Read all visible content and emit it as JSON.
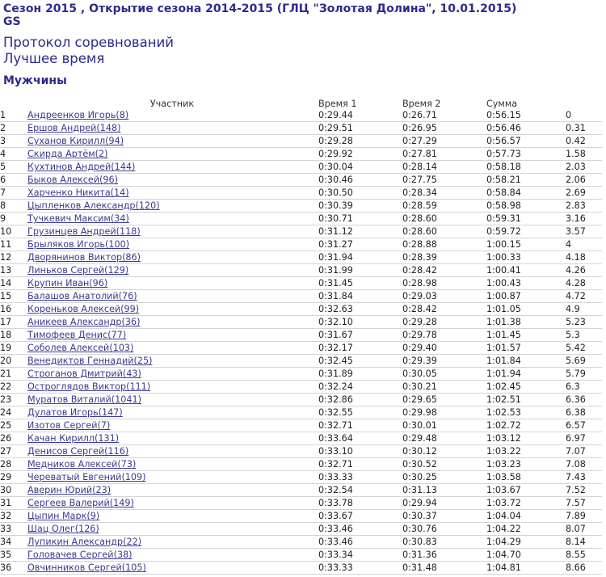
{
  "header": {
    "title": "Сезон 2015 , Открытие сезона 2014-2015 (ГЛЦ \"Золотая Долина\", 10.01.2015)",
    "discipline": "GS",
    "protocol": "Протокол соревнований",
    "best_time": "Лучшее время",
    "group": "Мужчины"
  },
  "table": {
    "columns": [
      "",
      "Участник",
      "Время 1",
      "Время 2",
      "Сумма",
      ""
    ],
    "rows": [
      {
        "place": "1",
        "name": "Андреенков Игорь(8)",
        "t1": "0:29.44",
        "t2": "0:26.71",
        "sum": "0:56.15",
        "gap": "0"
      },
      {
        "place": "2",
        "name": "Ершов Андрей(148)",
        "t1": "0:29.51",
        "t2": "0:26.95",
        "sum": "0:56.46",
        "gap": "0.31"
      },
      {
        "place": "3",
        "name": "Суханов Кирилл(94)",
        "t1": "0:29.28",
        "t2": "0:27.29",
        "sum": "0:56.57",
        "gap": "0.42"
      },
      {
        "place": "4",
        "name": "Скирда Артём(2)",
        "t1": "0:29.92",
        "t2": "0:27.81",
        "sum": "0:57.73",
        "gap": "1.58"
      },
      {
        "place": "5",
        "name": "Кухтинов Андрей(144)",
        "t1": "0:30.04",
        "t2": "0:28.14",
        "sum": "0:58.18",
        "gap": "2.03"
      },
      {
        "place": "6",
        "name": "Быков Алексей(96)",
        "t1": "0:30.46",
        "t2": "0:27.75",
        "sum": "0:58.21",
        "gap": "2.06"
      },
      {
        "place": "7",
        "name": "Харченко Никита(14)",
        "t1": "0:30.50",
        "t2": "0:28.34",
        "sum": "0:58.84",
        "gap": "2.69"
      },
      {
        "place": "8",
        "name": "Цыпленков Александр(120)",
        "t1": "0:30.39",
        "t2": "0:28.59",
        "sum": "0:58.98",
        "gap": "2.83"
      },
      {
        "place": "9",
        "name": "Тучкевич Максим(34)",
        "t1": "0:30.71",
        "t2": "0:28.60",
        "sum": "0:59.31",
        "gap": "3.16"
      },
      {
        "place": "10",
        "name": "Грузинцев Андрей(118)",
        "t1": "0:31.12",
        "t2": "0:28.60",
        "sum": "0:59.72",
        "gap": "3.57"
      },
      {
        "place": "11",
        "name": "Брыляков Игорь(100)",
        "t1": "0:31.27",
        "t2": "0:28.88",
        "sum": "1:00.15",
        "gap": "4"
      },
      {
        "place": "12",
        "name": "Дворянинов Виктор(86)",
        "t1": "0:31.94",
        "t2": "0:28.39",
        "sum": "1:00.33",
        "gap": "4.18"
      },
      {
        "place": "13",
        "name": "Линьков Сергей(129)",
        "t1": "0:31.99",
        "t2": "0:28.42",
        "sum": "1:00.41",
        "gap": "4.26"
      },
      {
        "place": "14",
        "name": "Крупин Иван(96)",
        "t1": "0:31.45",
        "t2": "0:28.98",
        "sum": "1:00.43",
        "gap": "4.28"
      },
      {
        "place": "15",
        "name": "Балашов Анатолий(76)",
        "t1": "0:31.84",
        "t2": "0:29.03",
        "sum": "1:00.87",
        "gap": "4.72"
      },
      {
        "place": "16",
        "name": "Кореньков Алексей(99)",
        "t1": "0:32.63",
        "t2": "0:28.42",
        "sum": "1:01.05",
        "gap": "4.9"
      },
      {
        "place": "17",
        "name": "Аникеев Александр(36)",
        "t1": "0:32.10",
        "t2": "0:29.28",
        "sum": "1:01.38",
        "gap": "5.23"
      },
      {
        "place": "18",
        "name": "Тимофеев Денис(77)",
        "t1": "0:31.67",
        "t2": "0:29.78",
        "sum": "1:01.45",
        "gap": "5.3"
      },
      {
        "place": "19",
        "name": "Соболев Алексей(103)",
        "t1": "0:32.17",
        "t2": "0:29.40",
        "sum": "1:01.57",
        "gap": "5.42"
      },
      {
        "place": "20",
        "name": "Венедиктов Геннадий(25)",
        "t1": "0:32.45",
        "t2": "0:29.39",
        "sum": "1:01.84",
        "gap": "5.69"
      },
      {
        "place": "21",
        "name": "Строганов Дмитрий(43)",
        "t1": "0:31.89",
        "t2": "0:30.05",
        "sum": "1:01.94",
        "gap": "5.79"
      },
      {
        "place": "22",
        "name": "Остроглядов Виктор(111)",
        "t1": "0:32.24",
        "t2": "0:30.21",
        "sum": "1:02.45",
        "gap": "6.3"
      },
      {
        "place": "23",
        "name": "Муратов Виталий(1041)",
        "t1": "0:32.86",
        "t2": "0:29.65",
        "sum": "1:02.51",
        "gap": "6.36"
      },
      {
        "place": "24",
        "name": "Дулатов Игорь(147)",
        "t1": "0:32.55",
        "t2": "0:29.98",
        "sum": "1:02.53",
        "gap": "6.38"
      },
      {
        "place": "25",
        "name": "Изотов Сергей(7)",
        "t1": "0:32.71",
        "t2": "0:30.01",
        "sum": "1:02.72",
        "gap": "6.57"
      },
      {
        "place": "26",
        "name": "Качан Кирилл(131)",
        "t1": "0:33.64",
        "t2": "0:29.48",
        "sum": "1:03.12",
        "gap": "6.97"
      },
      {
        "place": "27",
        "name": "Денисов Сергей(116)",
        "t1": "0:33.10",
        "t2": "0:30.12",
        "sum": "1:03.22",
        "gap": "7.07"
      },
      {
        "place": "28",
        "name": "Медников Алексей(73)",
        "t1": "0:32.71",
        "t2": "0:30.52",
        "sum": "1:03.23",
        "gap": "7.08"
      },
      {
        "place": "29",
        "name": "Череватый Евгений(109)",
        "t1": "0:33.33",
        "t2": "0:30.25",
        "sum": "1:03.58",
        "gap": "7.43"
      },
      {
        "place": "30",
        "name": "Аверин Юрий(23)",
        "t1": "0:32.54",
        "t2": "0:31.13",
        "sum": "1:03.67",
        "gap": "7.52"
      },
      {
        "place": "31",
        "name": "Сергеев Валерий(149)",
        "t1": "0:33.78",
        "t2": "0:29.94",
        "sum": "1:03.72",
        "gap": "7.57"
      },
      {
        "place": "32",
        "name": "Цыпин Марк(9)",
        "t1": "0:33.67",
        "t2": "0:30.37",
        "sum": "1:04.04",
        "gap": "7.89"
      },
      {
        "place": "33",
        "name": "Шац Олег(126)",
        "t1": "0:33.46",
        "t2": "0:30.76",
        "sum": "1:04.22",
        "gap": "8.07"
      },
      {
        "place": "34",
        "name": "Лупикин Александр(22)",
        "t1": "0:33.46",
        "t2": "0:30.83",
        "sum": "1:04.29",
        "gap": "8.14"
      },
      {
        "place": "35",
        "name": "Головачев Сергей(38)",
        "t1": "0:33.34",
        "t2": "0:31.36",
        "sum": "1:04.70",
        "gap": "8.55"
      },
      {
        "place": "36",
        "name": "Овчинников Сергей(105)",
        "t1": "0:33.33",
        "t2": "0:31.48",
        "sum": "1:04.81",
        "gap": "8.66"
      }
    ]
  }
}
